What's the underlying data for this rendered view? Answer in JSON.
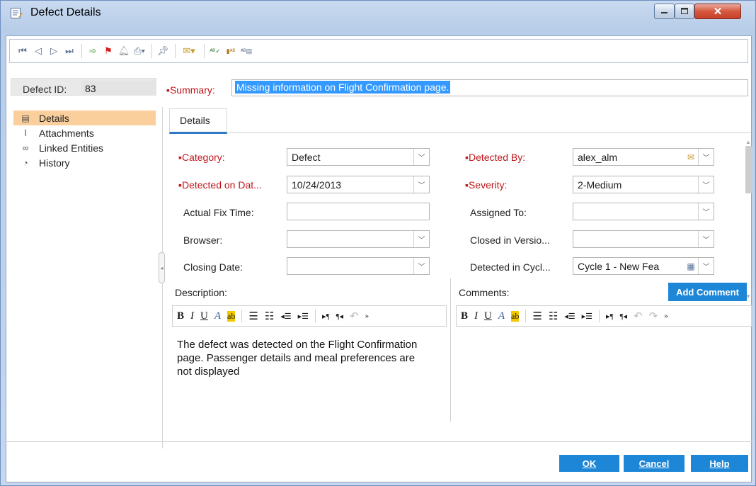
{
  "window": {
    "title": "Defect Details"
  },
  "defect": {
    "id_label": "Defect ID:",
    "id_value": "83"
  },
  "summary": {
    "label": "Summary:",
    "value": "Missing information on Flight Confirmation page."
  },
  "nav": [
    {
      "label": "Details",
      "icon": "details-icon"
    },
    {
      "label": "Attachments",
      "icon": "paperclip-icon"
    },
    {
      "label": "Linked Entities",
      "icon": "link-icon"
    },
    {
      "label": "History",
      "icon": "history-icon"
    }
  ],
  "tabs": {
    "details": "Details"
  },
  "fields": {
    "category": {
      "label": "Category:",
      "value": "Defect"
    },
    "detected_on": {
      "label": "Detected on Dat...",
      "value": "10/24/2013"
    },
    "actual_fix_time": {
      "label": "Actual Fix Time:",
      "value": ""
    },
    "browser": {
      "label": "Browser:",
      "value": ""
    },
    "closing_date": {
      "label": "Closing Date:",
      "value": ""
    },
    "detected_by": {
      "label": "Detected By:",
      "value": "alex_alm"
    },
    "severity": {
      "label": "Severity:",
      "value": "2-Medium"
    },
    "assigned_to": {
      "label": "Assigned To:",
      "value": ""
    },
    "closed_in_version": {
      "label": "Closed in Versio...",
      "value": ""
    },
    "detected_in_cycle": {
      "label": "Detected in Cycl...",
      "value": "Cycle 1 - New Fea"
    }
  },
  "description": {
    "title": "Description:",
    "text": "The defect was detected on the Flight Confirmation page. Passenger details and meal preferences are not displayed"
  },
  "comments": {
    "title": "Comments:",
    "add_label": "Add Comment"
  },
  "buttons": {
    "ok": "OK",
    "cancel": "Cancel",
    "help": "Help"
  },
  "colors": {
    "required": "#c0161b",
    "accent": "#1e86d6",
    "selection": "#fbcf9c"
  }
}
